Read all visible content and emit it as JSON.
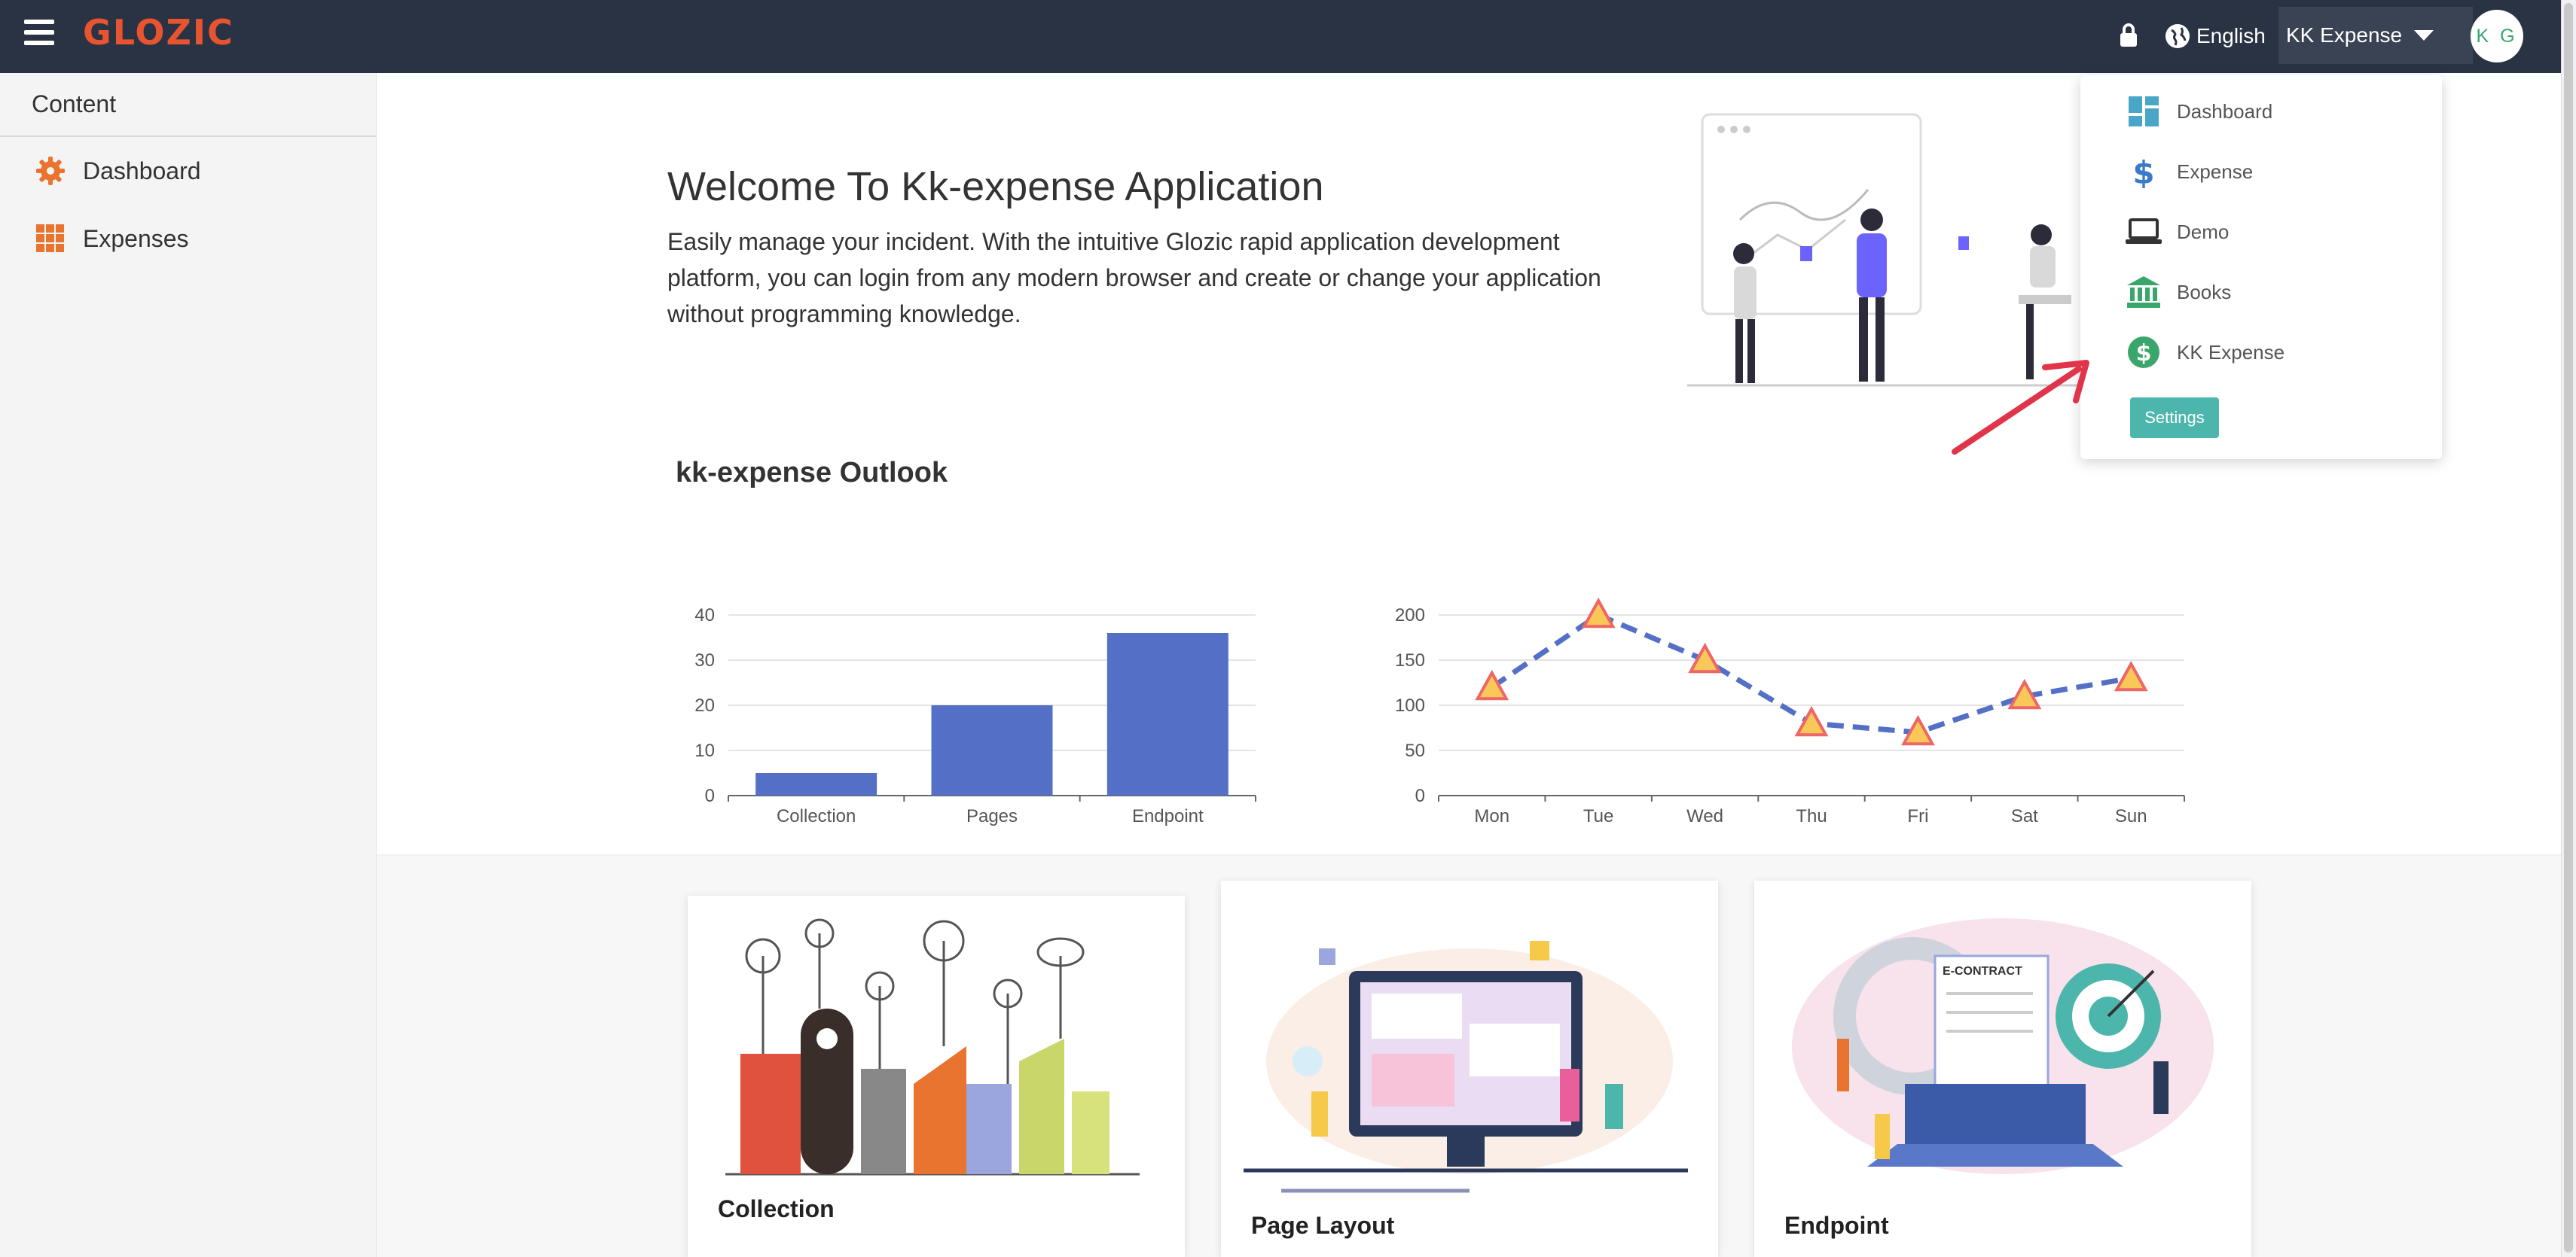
{
  "header": {
    "logo": "GLOZIC",
    "language": "English",
    "app_selector": "KK Expense",
    "avatar_initials": "K G"
  },
  "sidebar": {
    "title": "Content",
    "items": [
      {
        "label": "Dashboard",
        "icon": "gear-icon"
      },
      {
        "label": "Expenses",
        "icon": "grid-icon"
      }
    ]
  },
  "main": {
    "welcome_title": "Welcome To Kk-expense Application",
    "welcome_text": "Easily manage your incident. With the intuitive Glozic rapid application development platform, you can login from any modern browser and create or change your application without programming knowledge.",
    "outlook_title": "kk-expense Outlook",
    "cards": [
      {
        "title": "Collection"
      },
      {
        "title": "Page Layout"
      },
      {
        "title": "Endpoint"
      }
    ]
  },
  "dropdown": {
    "items": [
      {
        "label": "Dashboard",
        "icon": "dashboard-icon"
      },
      {
        "label": "Expense",
        "icon": "dollar-icon"
      },
      {
        "label": "Demo",
        "icon": "laptop-icon"
      },
      {
        "label": "Books",
        "icon": "bank-icon"
      },
      {
        "label": "KK Expense",
        "icon": "dollar-circle-icon"
      }
    ],
    "settings_label": "Settings"
  },
  "colors": {
    "header_bg": "#2a3344",
    "logo": "#e8542f",
    "bar": "#5470c6",
    "line": "#5470c6",
    "marker_fill": "#fac858",
    "marker_stroke": "#ee6666",
    "settings_button": "#4db6ac"
  },
  "chart_data": [
    {
      "type": "bar",
      "categories": [
        "Collection",
        "Pages",
        "Endpoint"
      ],
      "values": [
        5,
        20,
        36
      ],
      "ylim": [
        0,
        40
      ],
      "yticks": [
        0,
        10,
        20,
        30,
        40
      ]
    },
    {
      "type": "line",
      "categories": [
        "Mon",
        "Tue",
        "Wed",
        "Thu",
        "Fri",
        "Sat",
        "Sun"
      ],
      "values": [
        120,
        200,
        150,
        80,
        70,
        110,
        130
      ],
      "ylim": [
        0,
        200
      ],
      "yticks": [
        0,
        50,
        100,
        150,
        200
      ],
      "line_style": "dashed",
      "marker": "triangle"
    }
  ]
}
